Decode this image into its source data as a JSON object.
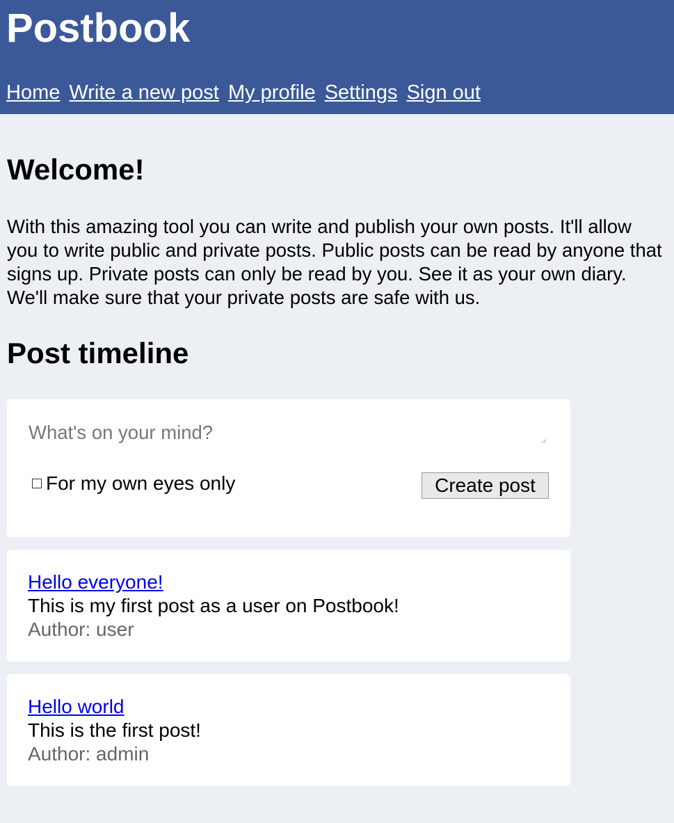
{
  "header": {
    "brand": "Postbook",
    "nav": [
      "Home",
      "Write a new post",
      "My profile",
      "Settings",
      "Sign out"
    ]
  },
  "welcome": {
    "heading": "Welcome!",
    "text": "With this amazing tool you can write and publish your own posts. It'll allow you to write public and private posts. Public posts can be read by anyone that signs up. Private posts can only be read by you. See it as your own diary. We'll make sure that your private posts are safe with us."
  },
  "timeline": {
    "heading": "Post timeline",
    "composer": {
      "placeholder": "What's on your mind?",
      "private_label": "For my own eyes only",
      "private_checked": false,
      "submit_label": "Create post"
    },
    "posts": [
      {
        "title": "Hello everyone!",
        "body": "This is my first post as a user on Postbook!",
        "author": "Author: user"
      },
      {
        "title": "Hello world",
        "body": "This is the first post!",
        "author": "Author: admin"
      }
    ]
  },
  "colors": {
    "header_bg": "#3b5998",
    "page_bg": "#eceff4",
    "link": "#0000ee"
  }
}
